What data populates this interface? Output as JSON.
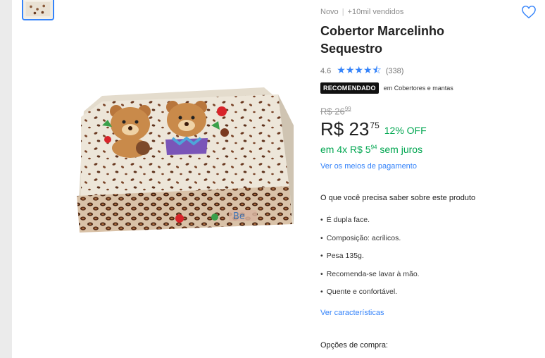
{
  "product": {
    "condition": "Novo",
    "sold": "+10mil vendidos",
    "title": "Cobertor Marcelinho Sequestro",
    "rating": "4.6",
    "stars": "★★★★⯪",
    "reviews": "(338)",
    "badge": "RECOMENDADO",
    "badge_context": "em Cobertores e mantas"
  },
  "pricing": {
    "old_price": "R$ 26",
    "old_price_cents": "99",
    "price": "R$ 23",
    "price_cents": "75",
    "discount": "12% OFF",
    "installments_prefix": "em",
    "installments_main": "4x R$ 5",
    "installments_cents": "94",
    "installments_suffix": "sem juros",
    "payment_link": "Ver os meios de pagamento"
  },
  "details": {
    "heading": "O que você precisa saber sobre este produto",
    "features": [
      "É dupla face.",
      "Composição: acrílicos.",
      "Pesa 135g.",
      "Recomenda-se lavar à mão.",
      "Quente e confortável."
    ],
    "characteristics_link": "Ver características",
    "buy_options": "Opções de compra:"
  },
  "colors": {
    "accent": "#3483fa",
    "green": "#00a650",
    "badge_bg": "#111111"
  },
  "icons": {
    "favorite": "heart-icon",
    "rating": "star-icon"
  }
}
